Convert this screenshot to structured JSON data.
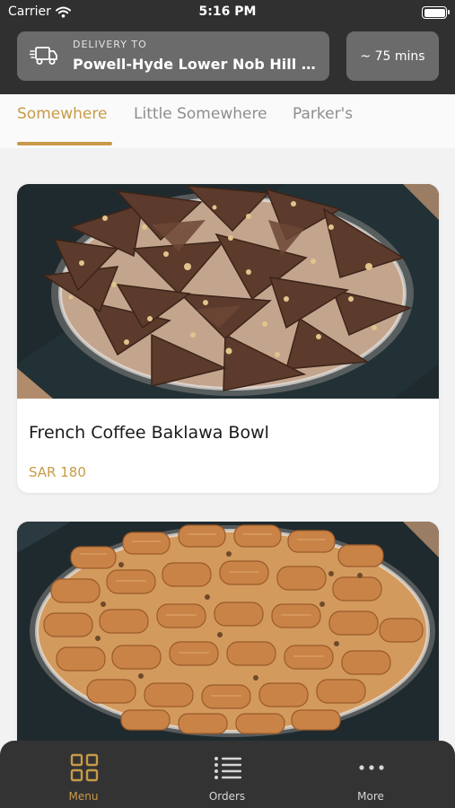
{
  "status_bar": {
    "carrier": "Carrier",
    "time": "5:16 PM"
  },
  "header": {
    "delivery_label": "DELIVERY TO",
    "delivery_address": "Powell-Hyde Lower Nob Hill Sa...",
    "eta": "~ 75 mins"
  },
  "tabs": [
    {
      "label": "Somewhere",
      "active": true
    },
    {
      "label": "Little Somewhere",
      "active": false
    },
    {
      "label": "Parker's",
      "active": false
    }
  ],
  "products": [
    {
      "name": "French Coffee Baklawa Bowl",
      "price": "SAR 180",
      "image": "chocolate-baklawa-photo"
    },
    {
      "name": "",
      "price": "",
      "image": "baklawa-rolls-photo"
    }
  ],
  "bottom_nav": [
    {
      "label": "Menu",
      "icon": "grid-icon",
      "active": true
    },
    {
      "label": "Orders",
      "icon": "list-icon",
      "active": false
    },
    {
      "label": "More",
      "icon": "more-dots-icon",
      "active": false
    }
  ],
  "colors": {
    "accent": "#c89a48",
    "header_bg": "#303030",
    "pill_bg": "#6b6b6b",
    "tabbar_bg": "#333333",
    "tab_inactive": "#8e8e8e"
  }
}
